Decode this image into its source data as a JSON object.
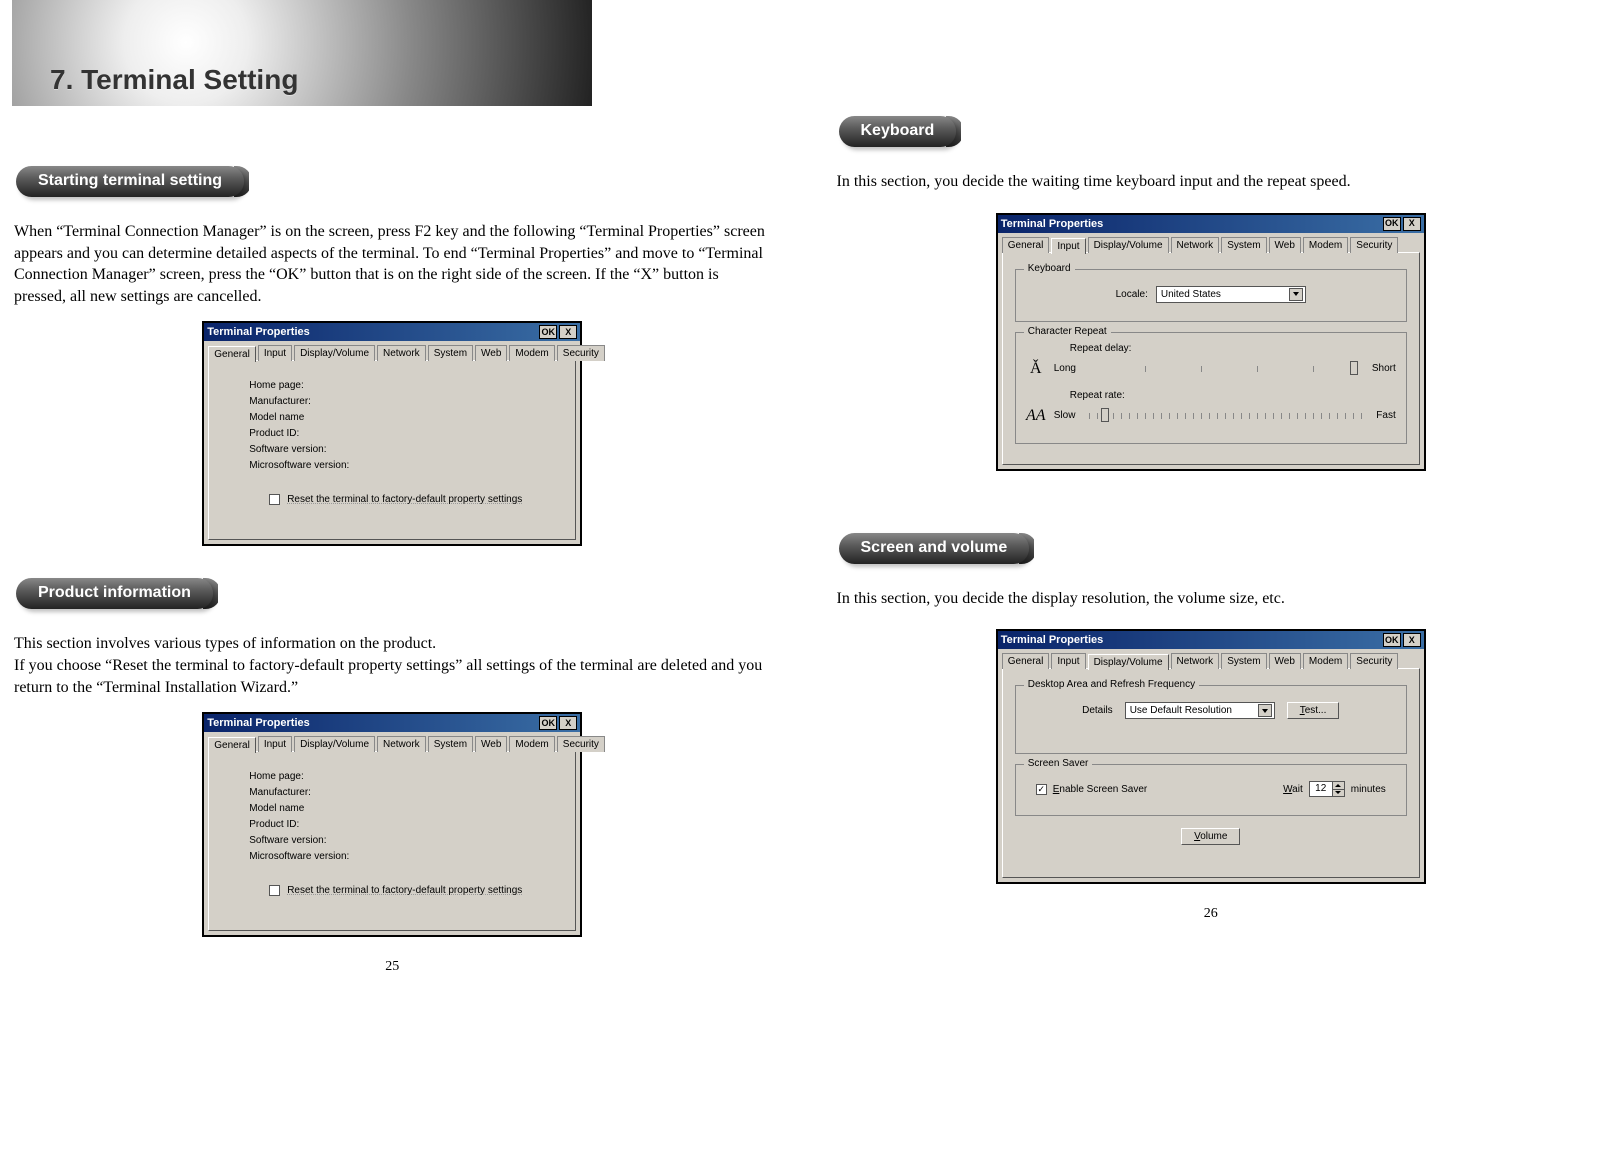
{
  "chapter": {
    "title": "7. Terminal Setting"
  },
  "sections": {
    "starting": {
      "heading": "Starting terminal setting",
      "body": "When “Terminal Connection Manager” is on the screen, press F2 key and the following “Terminal Properties” screen appears and you can determine detailed aspects of the terminal. To end “Terminal Properties” and move to “Terminal Connection Manager” screen, press the “OK” button that is on the right side of the screen. If the “X” button is pressed, all new settings are cancelled."
    },
    "product_info": {
      "heading": "Product information",
      "body": "This section involves various types of information on the product.\nIf you choose “Reset the terminal to factory-default property settings” all settings of the terminal are deleted and you return to the “Terminal Installation Wizard.”"
    },
    "keyboard": {
      "heading": "Keyboard",
      "body": "In this section, you decide the waiting time keyboard input and the repeat speed."
    },
    "screen_volume": {
      "heading": "Screen and volume",
      "body": "In this section, you decide the display resolution, the volume size, etc."
    }
  },
  "dialog_common": {
    "title": "Terminal Properties",
    "ok": "OK",
    "close": "X",
    "tabs": [
      "General",
      "Input",
      "Display/Volume",
      "Network",
      "System",
      "Web",
      "Modem",
      "Security"
    ]
  },
  "general_dialog": {
    "props": [
      "Home page:",
      "Manufacturer:",
      "Model name",
      "Product ID:",
      "Software version:",
      "Microsoftware version:"
    ],
    "reset_label": "Reset the terminal to factory-default property settings"
  },
  "keyboard_dialog": {
    "group1": "Keyboard",
    "locale_label": "Locale:",
    "locale_value": "United States",
    "group2": "Character Repeat",
    "repeat_delay": "Repeat delay:",
    "repeat_rate": "Repeat rate:",
    "long": "Long",
    "short": "Short",
    "slow": "Slow",
    "fast": "Fast"
  },
  "display_dialog": {
    "group1": "Desktop Area and Refresh Frequency",
    "details": "Details",
    "resolution": "Use Default Resolution",
    "test": "Test...",
    "group2": "Screen Saver",
    "enable_ss": "Enable Screen Saver",
    "wait": "Wait",
    "wait_val": "12",
    "minutes": "minutes",
    "volume_btn": "Volume"
  },
  "pagenums": {
    "left": "25",
    "right": "26"
  }
}
